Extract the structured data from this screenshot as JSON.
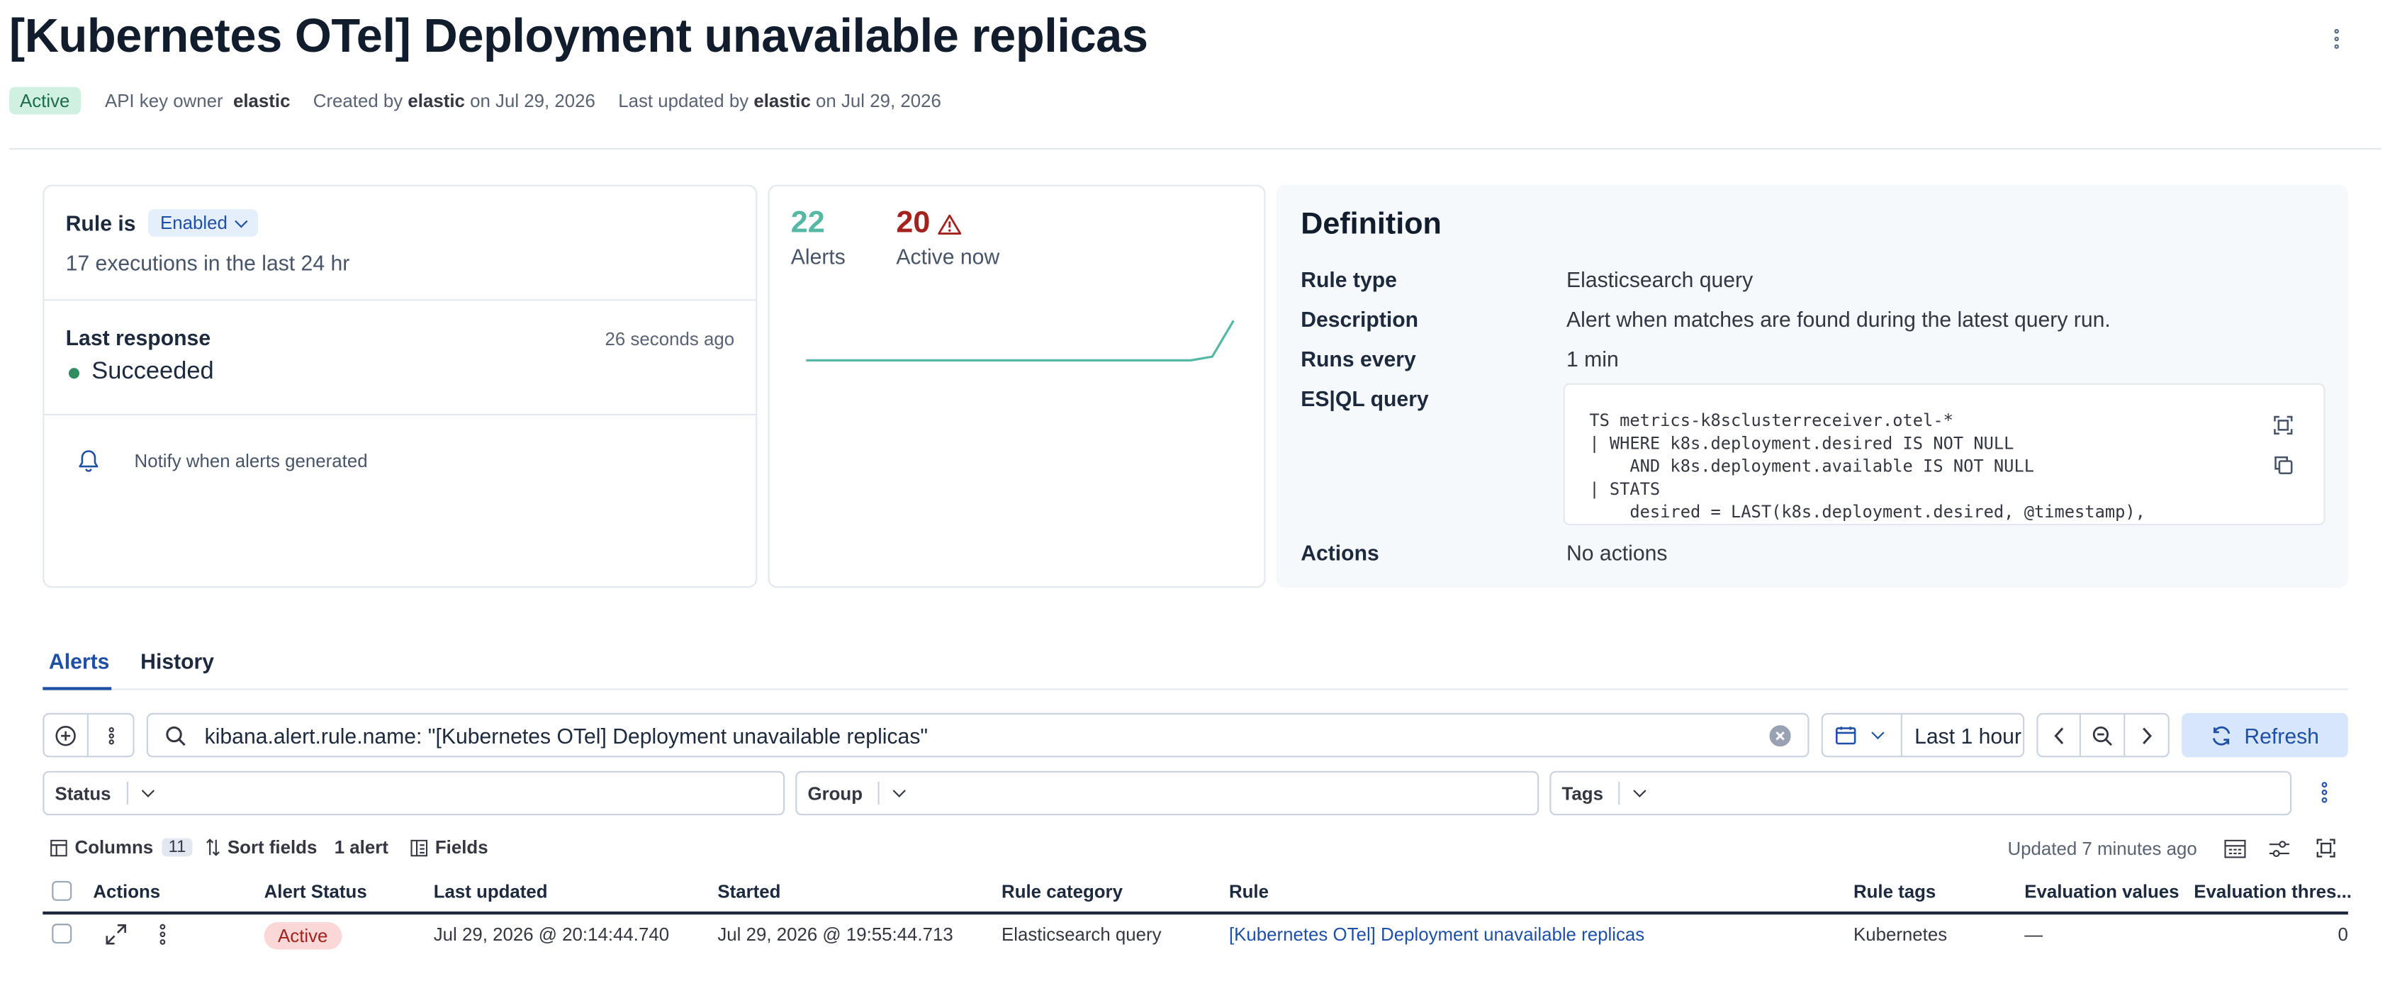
{
  "page": {
    "title": "[Kubernetes OTel] Deployment unavailable replicas"
  },
  "meta": {
    "status": "Active",
    "api_key_label": "API key owner",
    "api_key_owner": "elastic",
    "created_prefix": "Created by",
    "created_by": "elastic",
    "created_on": "on Jul 29, 2026",
    "updated_prefix": "Last updated by",
    "updated_by": "elastic",
    "updated_on": "on Jul 29, 2026"
  },
  "rule_status": {
    "label": "Rule is",
    "state": "Enabled",
    "executions": "17 executions in the last 24 hr",
    "last_response_label": "Last response",
    "last_response_time": "26 seconds ago",
    "last_response_value": "Succeeded",
    "notify": "Notify when alerts generated"
  },
  "alerts_summary": {
    "total": "22",
    "total_label": "Alerts",
    "active": "20",
    "active_label": "Active now",
    "colors": {
      "total": "#54b8a5",
      "active": "#a3221d"
    }
  },
  "definition": {
    "title": "Definition",
    "rule_type_label": "Rule type",
    "rule_type": "Elasticsearch query",
    "description_label": "Description",
    "description": "Alert when matches are found during the latest query run.",
    "runs_every_label": "Runs every",
    "runs_every": "1 min",
    "esql_label": "ES|QL query",
    "esql_lines": [
      "TS metrics-k8sclusterreceiver.otel-*",
      "| WHERE k8s.deployment.desired IS NOT NULL",
      "    AND k8s.deployment.available IS NOT NULL",
      "| STATS",
      "    desired = LAST(k8s.deployment.desired, @timestamp),"
    ],
    "actions_label": "Actions",
    "actions": "No actions"
  },
  "tabs": [
    {
      "label": "Alerts",
      "selected": true
    },
    {
      "label": "History",
      "selected": false
    }
  ],
  "search": {
    "query": "kibana.alert.rule.name: \"[Kubernetes OTel] Deployment unavailable replicas\"",
    "time_range": "Last 1 hour",
    "refresh_label": "Refresh"
  },
  "filters": [
    {
      "label": "Status"
    },
    {
      "label": "Group"
    },
    {
      "label": "Tags"
    }
  ],
  "table_toolbar": {
    "columns_label": "Columns",
    "columns_count": "11",
    "sort_label": "Sort fields",
    "alert_count": "1 alert",
    "fields_label": "Fields",
    "updated": "Updated 7 minutes ago"
  },
  "table": {
    "headers": [
      "Actions",
      "Alert Status",
      "Last updated",
      "Started",
      "Rule category",
      "Rule",
      "Rule tags",
      "Evaluation values",
      "Evaluation thres..."
    ],
    "rows": [
      {
        "status": "Active",
        "last_updated": "Jul 29, 2026 @ 20:14:44.740",
        "started": "Jul 29, 2026 @ 19:55:44.713",
        "category": "Elasticsearch query",
        "rule": "[Kubernetes OTel] Deployment unavailable replicas",
        "tags": "Kubernetes",
        "eval_values": "—",
        "eval_threshold": "0"
      }
    ]
  },
  "chart_data": {
    "type": "line",
    "values": [
      0,
      0,
      0,
      0,
      0,
      0,
      0,
      0,
      0,
      0,
      0,
      0,
      0,
      0,
      0,
      0,
      0,
      0,
      0,
      2,
      22
    ],
    "color": "#54b8a5"
  }
}
